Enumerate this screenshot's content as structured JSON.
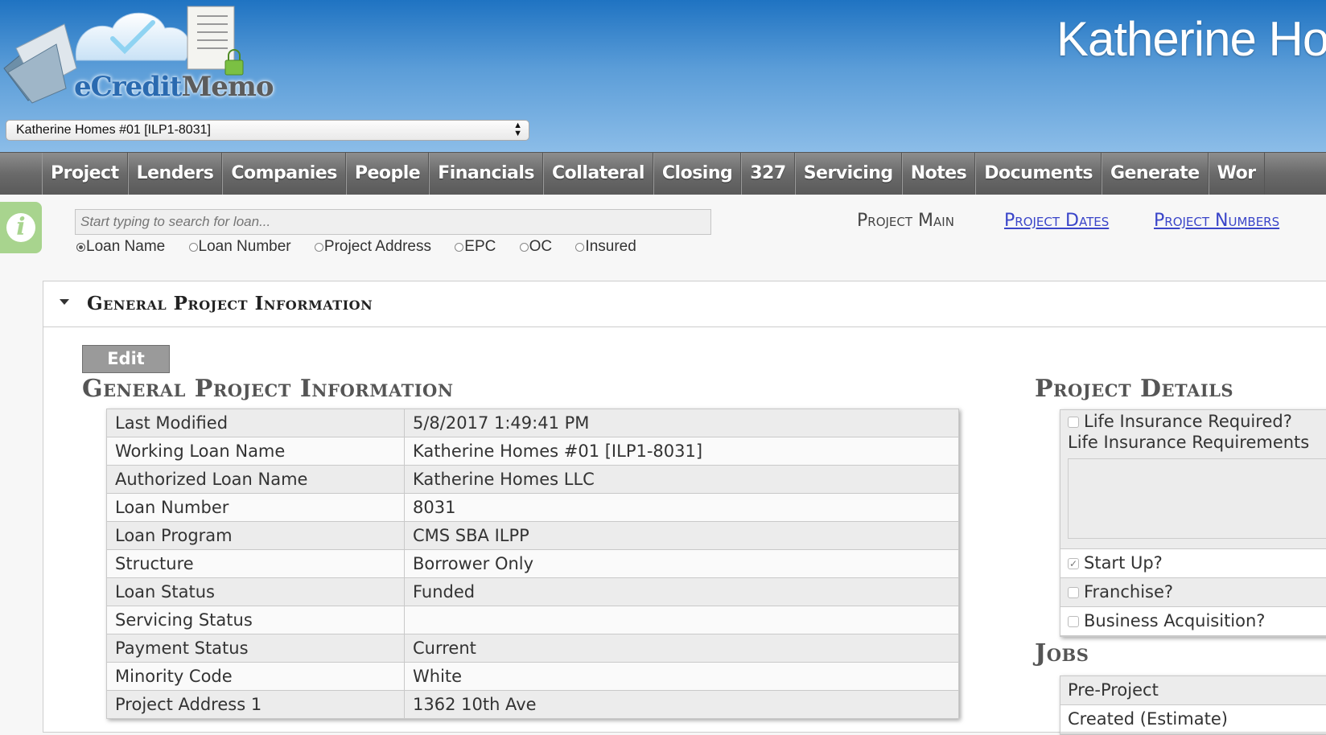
{
  "app": {
    "logo_text_e": "eCredit",
    "logo_text_memo": "Memo",
    "header_title": "Katherine Ho"
  },
  "loan_selector": {
    "selected": "Katherine Homes #01 [ILP1-8031]"
  },
  "nav": {
    "items": [
      "Project",
      "Lenders",
      "Companies",
      "People",
      "Financials",
      "Collateral",
      "Closing",
      "327",
      "Servicing",
      "Notes",
      "Documents",
      "Generate",
      "Wor"
    ]
  },
  "search": {
    "placeholder": "Start typing to search for loan...",
    "options": [
      "Loan Name",
      "Loan Number",
      "Project Address",
      "EPC",
      "OC",
      "Insured"
    ],
    "selected": "Loan Name"
  },
  "project_links": {
    "main": "Project Main",
    "dates": "Project Dates",
    "numbers": "Project Numbers"
  },
  "panel": {
    "title": "General Project Information",
    "edit_label": "Edit",
    "section_title": "General Project Information",
    "rows": [
      {
        "label": "Last Modified",
        "value": "5/8/2017 1:49:41 PM"
      },
      {
        "label": "Working Loan Name",
        "value": "Katherine Homes #01 [ILP1-8031]"
      },
      {
        "label": "Authorized Loan Name",
        "value": "Katherine Homes LLC"
      },
      {
        "label": "Loan Number",
        "value": "8031"
      },
      {
        "label": "Loan Program",
        "value": "CMS SBA ILPP"
      },
      {
        "label": "Structure",
        "value": "Borrower Only"
      },
      {
        "label": "Loan Status",
        "value": "Funded"
      },
      {
        "label": "Servicing Status",
        "value": ""
      },
      {
        "label": "Payment Status",
        "value": "Current"
      },
      {
        "label": "Minority Code",
        "value": "White"
      },
      {
        "label": "Project Address 1",
        "value": "1362 10th Ave"
      }
    ]
  },
  "details": {
    "title": "Project Details",
    "life_insurance_required": "Life Insurance Required?",
    "life_insurance_requirements": "Life Insurance Requirements",
    "start_up": "Start Up?",
    "franchise": "Franchise?",
    "business_acquisition": "Business Acquisition?"
  },
  "jobs": {
    "title": "Jobs",
    "rows": [
      "Pre-Project",
      "Created (Estimate)"
    ]
  }
}
